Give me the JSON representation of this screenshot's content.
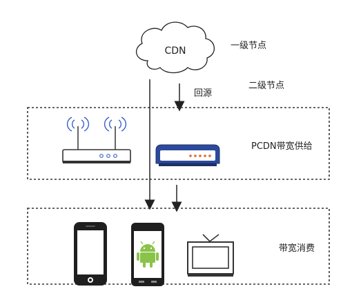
{
  "cloud": {
    "label": "CDN"
  },
  "tiers": {
    "level1": "一级节点",
    "level2": "二级节点"
  },
  "arrows": {
    "back_to_origin": "回源"
  },
  "boxes": {
    "supply": "PCDN带宽供给",
    "consume": "带宽消费"
  },
  "colors": {
    "line": "#222222",
    "router_led": "#3a62c9",
    "settopbox_blue": "#2c4a9b",
    "settopbox_led": "#e8642a",
    "android_green": "#8bc34a",
    "wifi_signal": "#3a62c9"
  },
  "devices": {
    "supply": [
      "router-icon",
      "set-top-box-icon"
    ],
    "consume": [
      "iphone-icon",
      "android-phone-icon",
      "tv-icon"
    ]
  }
}
